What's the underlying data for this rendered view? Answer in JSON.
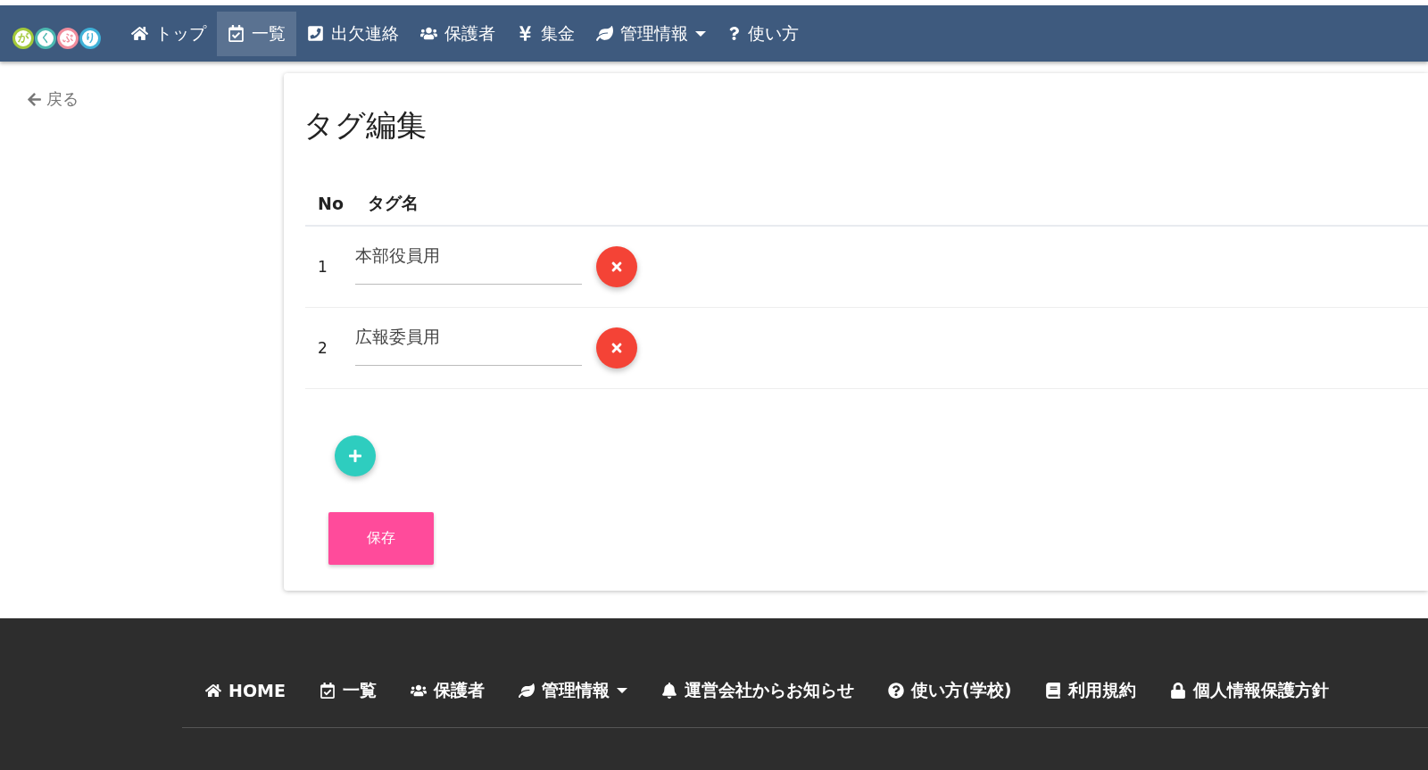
{
  "logo": {
    "letters": [
      {
        "char": "が",
        "color": "#a3c93a"
      },
      {
        "char": "く",
        "color": "#4cb8b0"
      },
      {
        "char": "ぷ",
        "color": "#f08c9c"
      },
      {
        "char": "り",
        "color": "#3fb1d8"
      }
    ]
  },
  "nav": {
    "items": [
      {
        "label": "トップ",
        "selected": false,
        "dropdown": false
      },
      {
        "label": "一覧",
        "selected": true,
        "dropdown": false
      },
      {
        "label": "出欠連絡",
        "selected": false,
        "dropdown": false
      },
      {
        "label": "保護者",
        "selected": false,
        "dropdown": false
      },
      {
        "label": "集金",
        "selected": false,
        "dropdown": false
      },
      {
        "label": "管理情報",
        "selected": false,
        "dropdown": true
      },
      {
        "label": "使い方",
        "selected": false,
        "dropdown": false
      }
    ]
  },
  "back_link": "戻る",
  "card": {
    "title": "タグ編集",
    "table": {
      "columns": [
        "No",
        "タグ名"
      ],
      "rows": [
        {
          "no": "1",
          "value": "本部役員用"
        },
        {
          "no": "2",
          "value": "広報委員用"
        }
      ]
    },
    "save_button": "保存"
  },
  "footer": {
    "items": [
      {
        "label": "HOME",
        "dropdown": false
      },
      {
        "label": "一覧",
        "dropdown": false
      },
      {
        "label": "保護者",
        "dropdown": false
      },
      {
        "label": "管理情報",
        "dropdown": true
      },
      {
        "label": "運営会社からお知らせ",
        "dropdown": false
      },
      {
        "label": "使い方(学校)",
        "dropdown": false
      },
      {
        "label": "利用規約",
        "dropdown": false
      },
      {
        "label": "個人情報保護方針",
        "dropdown": false
      }
    ]
  }
}
